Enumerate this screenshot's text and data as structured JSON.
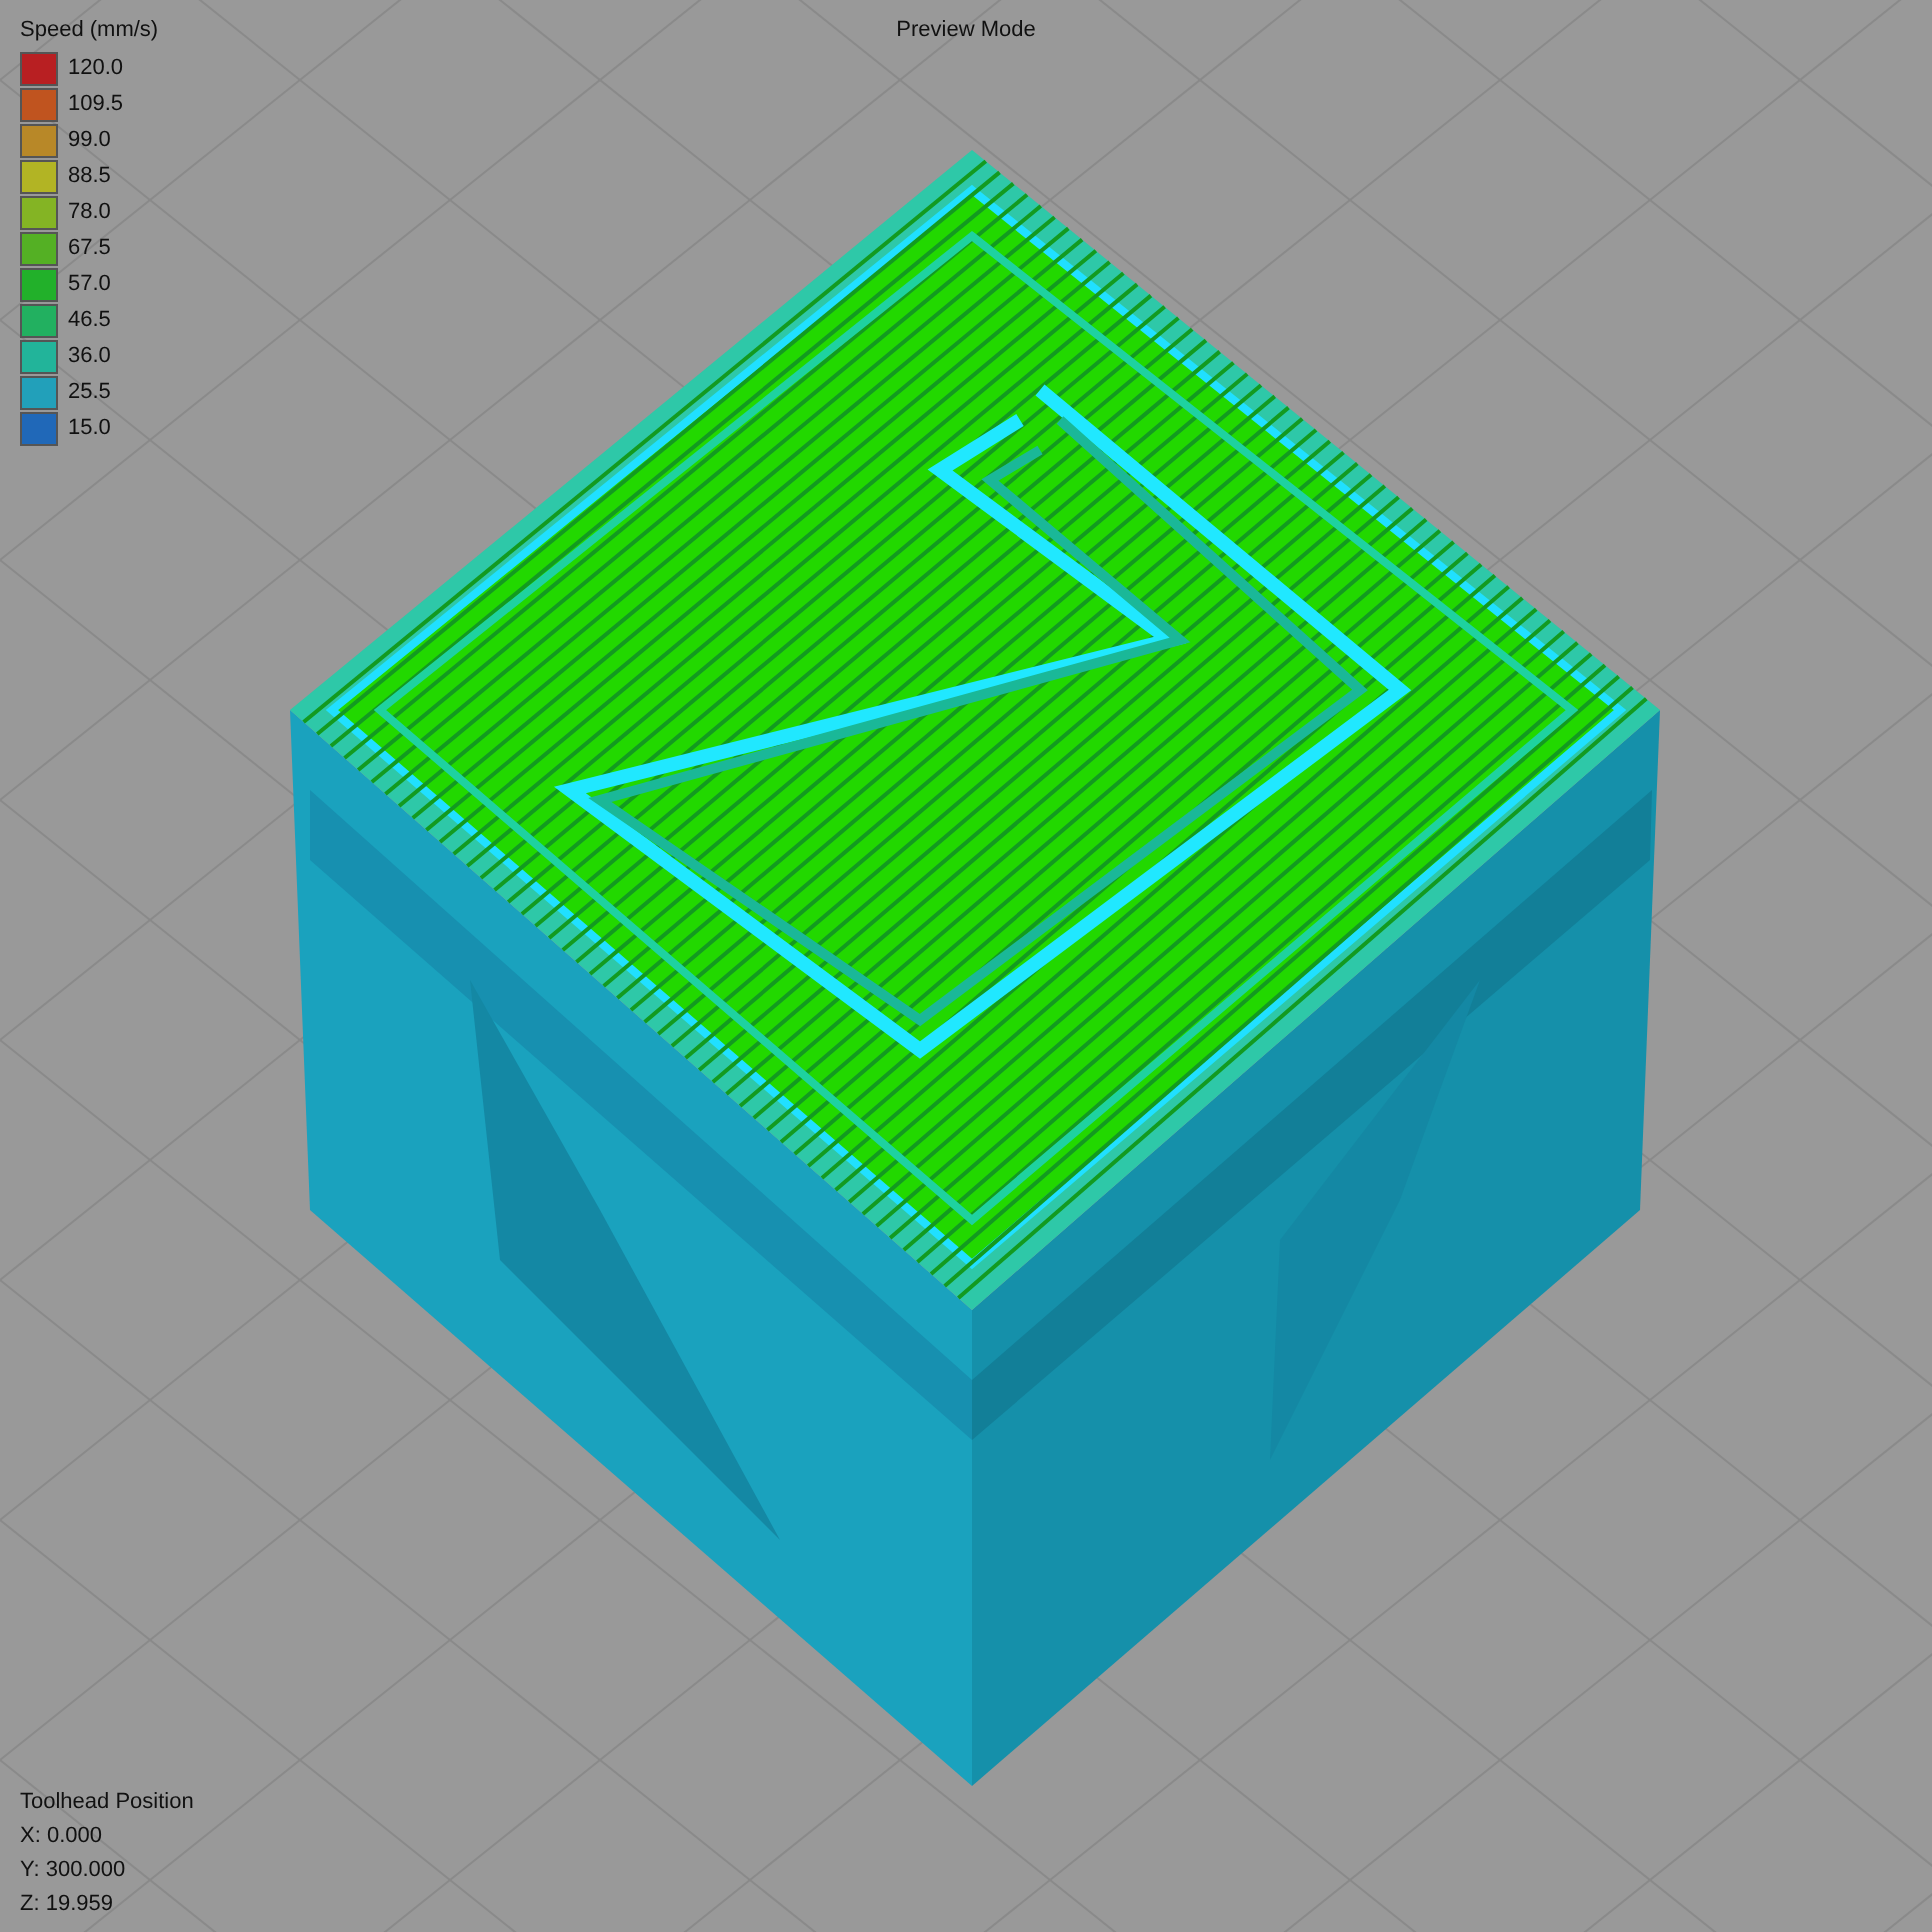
{
  "header": {
    "title": "Preview Mode"
  },
  "legend": {
    "title": "Speed (mm/s)",
    "items": [
      {
        "label": "120.0",
        "color": "#b81f22"
      },
      {
        "label": "109.5",
        "color": "#c0541f"
      },
      {
        "label": "99.0",
        "color": "#b88828"
      },
      {
        "label": "88.5",
        "color": "#b2b424"
      },
      {
        "label": "78.0",
        "color": "#84b424"
      },
      {
        "label": "67.5",
        "color": "#54b024"
      },
      {
        "label": "57.0",
        "color": "#22b02a"
      },
      {
        "label": "46.5",
        "color": "#22b060"
      },
      {
        "label": "36.0",
        "color": "#22b49a"
      },
      {
        "label": "25.5",
        "color": "#22a0ba"
      },
      {
        "label": "15.0",
        "color": "#2068b8"
      }
    ]
  },
  "toolhead": {
    "title": "Toolhead Position",
    "lines": [
      "X: 0.000",
      "Y: 300.000",
      "Z: 19.959"
    ]
  }
}
